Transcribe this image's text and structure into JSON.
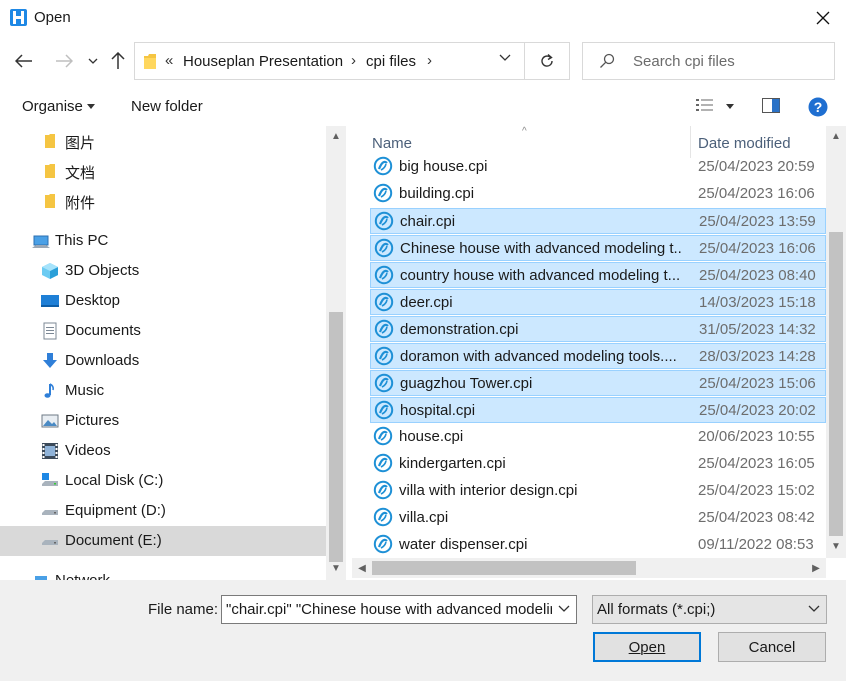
{
  "window": {
    "title": "Open"
  },
  "navigation": {
    "breadcrumbs": [
      "Houseplan Presentation",
      "cpi files"
    ],
    "search_placeholder": "Search cpi files"
  },
  "toolbar": {
    "organise_label": "Organise",
    "new_folder_label": "New folder"
  },
  "sidebar": {
    "items": [
      {
        "label": "图片",
        "icon": "folder-icon"
      },
      {
        "label": "文档",
        "icon": "folder-icon"
      },
      {
        "label": "附件",
        "icon": "folder-icon"
      },
      {
        "label": "This PC",
        "icon": "pc-icon"
      },
      {
        "label": "3D Objects",
        "icon": "cube-icon"
      },
      {
        "label": "Desktop",
        "icon": "desktop-icon"
      },
      {
        "label": "Documents",
        "icon": "documents-icon"
      },
      {
        "label": "Downloads",
        "icon": "download-icon"
      },
      {
        "label": "Music",
        "icon": "music-icon"
      },
      {
        "label": "Pictures",
        "icon": "pictures-icon"
      },
      {
        "label": "Videos",
        "icon": "video-icon"
      },
      {
        "label": "Local Disk (C:)",
        "icon": "drive-icon"
      },
      {
        "label": "Equipment (D:)",
        "icon": "drive-icon"
      },
      {
        "label": "Document (E:)",
        "icon": "drive-icon",
        "selected": true
      },
      {
        "label": "Network",
        "icon": "network-icon"
      }
    ]
  },
  "filelist": {
    "columns": {
      "name": "Name",
      "date": "Date modified"
    },
    "rows": [
      {
        "name": "big house.cpi",
        "date": "25/04/2023 20:59",
        "selected": false
      },
      {
        "name": "building.cpi",
        "date": "25/04/2023 16:06",
        "selected": false
      },
      {
        "name": "chair.cpi",
        "date": "25/04/2023 13:59",
        "selected": true
      },
      {
        "name": "Chinese house with advanced modeling t...",
        "date": "25/04/2023 16:06",
        "selected": true
      },
      {
        "name": "country house with advanced modeling t...",
        "date": "25/04/2023 08:40",
        "selected": true
      },
      {
        "name": "deer.cpi",
        "date": "14/03/2023 15:18",
        "selected": true
      },
      {
        "name": "demonstration.cpi",
        "date": "31/05/2023 14:32",
        "selected": true
      },
      {
        "name": "doramon with advanced modeling tools....",
        "date": "28/03/2023 14:28",
        "selected": true
      },
      {
        "name": "guagzhou Tower.cpi",
        "date": "25/04/2023 15:06",
        "selected": true
      },
      {
        "name": "hospital.cpi",
        "date": "25/04/2023 20:02",
        "selected": true
      },
      {
        "name": "house.cpi",
        "date": "20/06/2023 10:55",
        "selected": false
      },
      {
        "name": "kindergarten.cpi",
        "date": "25/04/2023 16:05",
        "selected": false
      },
      {
        "name": "villa with interior design.cpi",
        "date": "25/04/2023 15:02",
        "selected": false
      },
      {
        "name": "villa.cpi",
        "date": "25/04/2023 08:42",
        "selected": false
      },
      {
        "name": "water dispenser.cpi",
        "date": "09/11/2022 08:53",
        "selected": false
      }
    ]
  },
  "footer": {
    "filename_label": "File name:",
    "filename_value": "\"chair.cpi\" \"Chinese house with advanced modeling tools.cpi\"",
    "filetype_value": "All formats (*.cpi;)",
    "open_label": "Open",
    "cancel_label": "Cancel"
  },
  "colors": {
    "selection": "#cce8ff",
    "accent": "#0078d7",
    "file_icon": "#1e90d6"
  }
}
